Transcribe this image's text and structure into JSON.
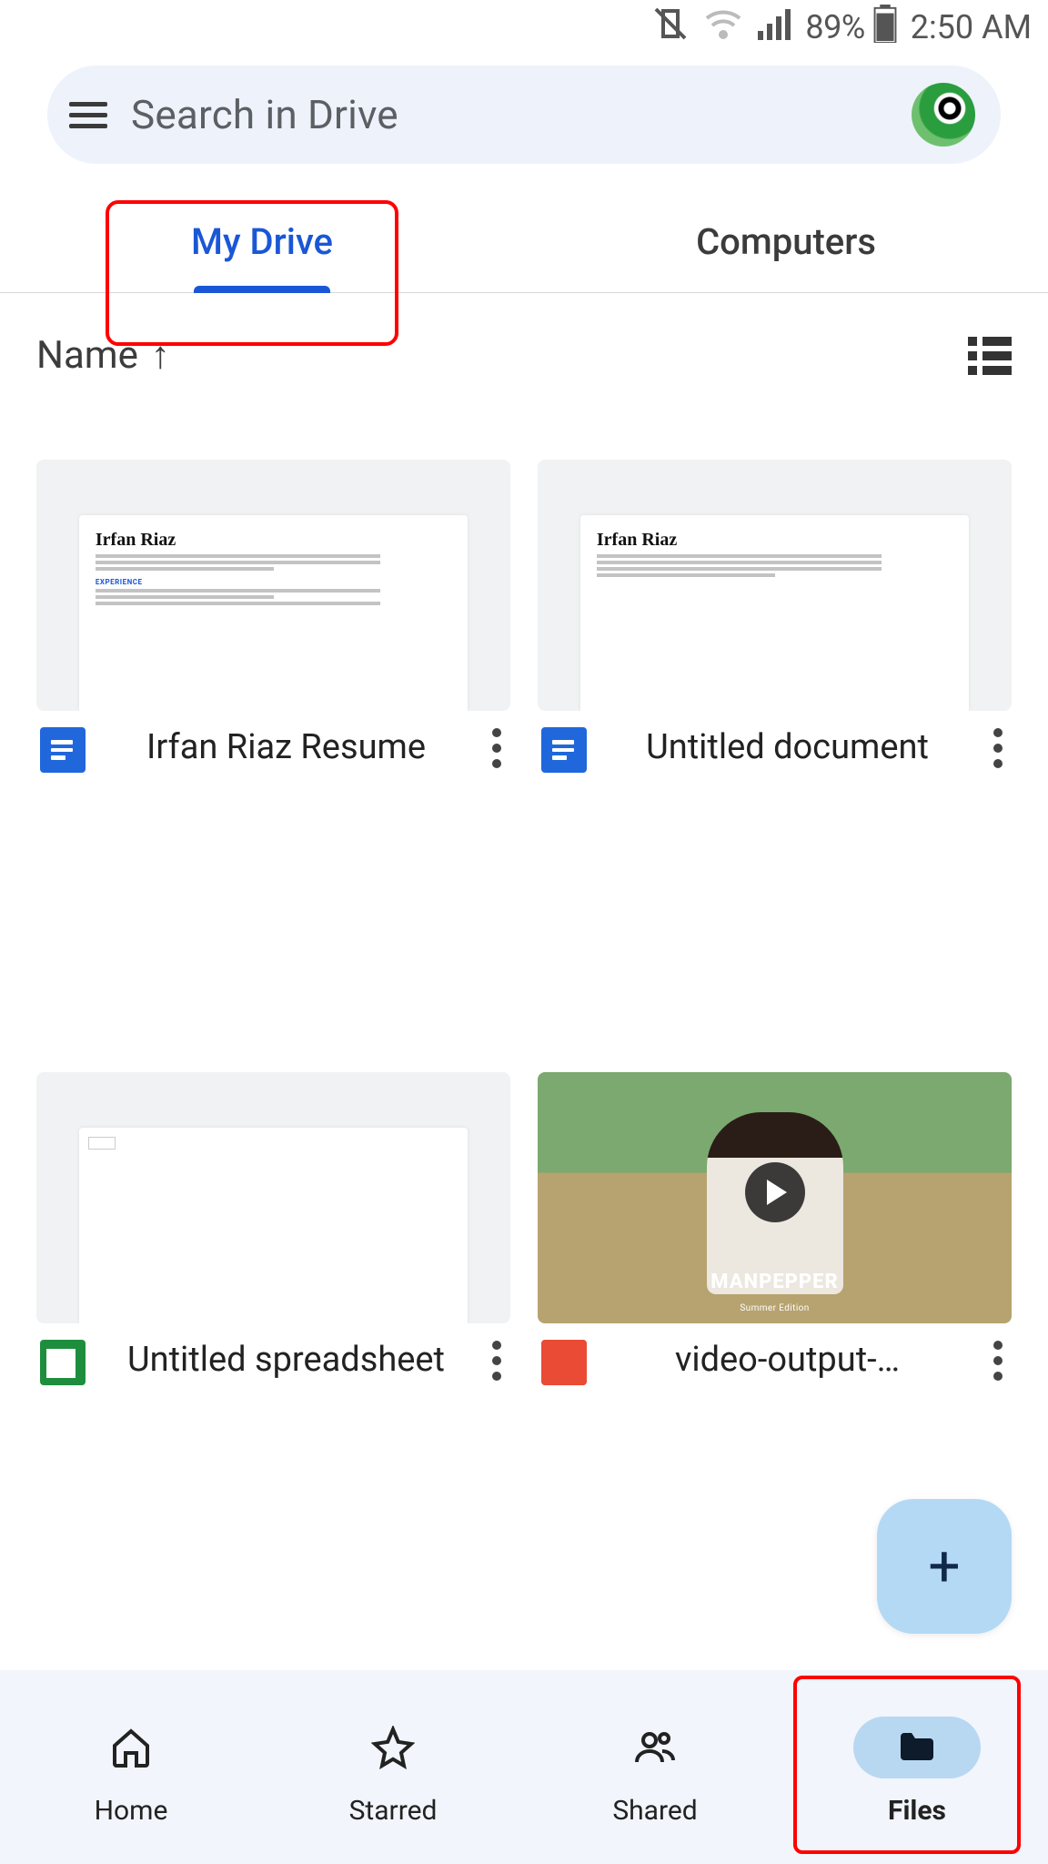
{
  "status_bar": {
    "battery_percent": "89%",
    "time": "2:50 AM"
  },
  "search": {
    "placeholder": "Search in Drive"
  },
  "tabs": {
    "my_drive": "My Drive",
    "computers": "Computers"
  },
  "sort": {
    "label": "Name",
    "direction_icon": "↑"
  },
  "files": [
    {
      "name": "Irfan Riaz Resume",
      "type": "docs",
      "preview_title": "Irfan Riaz"
    },
    {
      "name": "Untitled document",
      "type": "docs",
      "preview_title": "Irfan Riaz"
    },
    {
      "name": "Untitled spreadsheet",
      "type": "sheets",
      "preview_title": ""
    },
    {
      "name": "video-output-…",
      "type": "video",
      "preview_caption": "MANPEPPER",
      "preview_sub": "Summer Edition"
    }
  ],
  "fab": {
    "label": "+"
  },
  "bottom_nav": {
    "home": "Home",
    "starred": "Starred",
    "shared": "Shared",
    "files": "Files"
  }
}
